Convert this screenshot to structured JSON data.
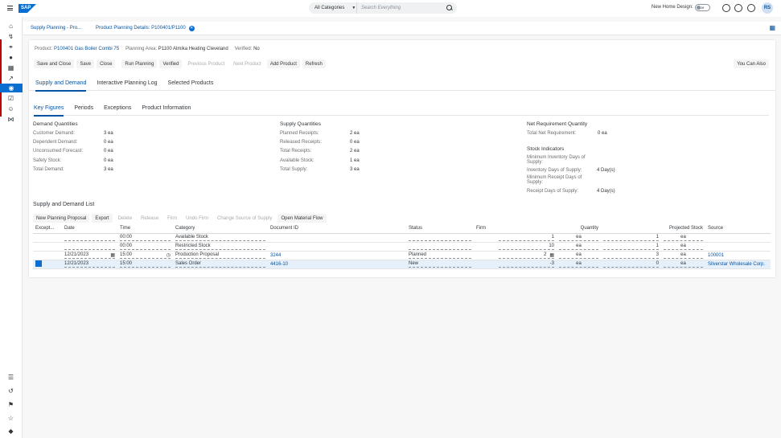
{
  "shell": {
    "category": "All Categories",
    "search_placeholder": "Search Everything",
    "new_home_label": "New Home Design:",
    "toggle_label": "Off",
    "avatar": "RS",
    "logo": "SAP"
  },
  "breadcrumbs": {
    "first": "Supply Planning - Pro...",
    "second": "Product Planning Details: P100401/P1100"
  },
  "header": {
    "product_label": "Product:",
    "product_value": "P100401 Gas Boiler Combi 75",
    "area_label": "Planning Area:",
    "area_value": "P1100 Almika Heating Cleveland",
    "verified_label": "Verified:",
    "verified_value": "No"
  },
  "toolbar": {
    "save_close": "Save and Close",
    "save": "Save",
    "close": "Close",
    "run_planning": "Run Planning",
    "verified": "Verified",
    "previous": "Previous Product",
    "next": "Next Product",
    "add": "Add Product",
    "refresh": "Refresh",
    "you_can_also": "You Can Also"
  },
  "tabs": [
    "Supply and Demand",
    "Interactive Planning Log",
    "Selected Products"
  ],
  "subtabs": [
    "Key Figures",
    "Periods",
    "Exceptions",
    "Product Information"
  ],
  "demand": {
    "title": "Demand Quantities",
    "rows": [
      {
        "k": "Customer Demand:",
        "v": "3 ea"
      },
      {
        "k": "Dependent Demand:",
        "v": "0 ea"
      },
      {
        "k": "Unconsumed Forecast:",
        "v": "0 ea"
      },
      {
        "k": "Safety Stock:",
        "v": "0 ea"
      },
      {
        "k": "Total Demand:",
        "v": "3 ea"
      }
    ]
  },
  "supply": {
    "title": "Supply Quantities",
    "rows": [
      {
        "k": "Planned Receipts:",
        "v": "2 ea"
      },
      {
        "k": "Released Receipts:",
        "v": "0 ea"
      },
      {
        "k": "Total Receipts:",
        "v": "2 ea"
      },
      {
        "k": "Available Stock:",
        "v": "1 ea"
      },
      {
        "k": "Total Supply:",
        "v": "3 ea"
      }
    ]
  },
  "net": {
    "title": "Net Requirement Quantity",
    "k": "Total Net Requirement:",
    "v": "0 ea"
  },
  "stock": {
    "title": "Stock Indicators",
    "rows": [
      {
        "k": "Minimum Inventory Days of Supply:",
        "v": ""
      },
      {
        "k": "Inventory Days of Supply:",
        "v": "4 Day(s)"
      },
      {
        "k": "Minimum Receipt Days of Supply:",
        "v": ""
      },
      {
        "k": "Receipt Days of Supply:",
        "v": "4 Day(s)"
      }
    ]
  },
  "list": {
    "title": "Supply and Demand List",
    "buttons": {
      "new_proposal": "New Planning Proposal",
      "export": "Export",
      "delete": "Delete",
      "release": "Release",
      "firm": "Firm",
      "unfirm": "Undo Firm",
      "change_source": "Change Source of Supply",
      "material_flow": "Open Material Flow"
    },
    "columns": {
      "exception": "Except...",
      "date": "Date",
      "time": "Time",
      "category": "Category",
      "document": "Document ID",
      "status": "Status",
      "firm": "Firm",
      "quantity": "Quantity",
      "projected": "Projected Stock",
      "source": "Source"
    },
    "rows": [
      {
        "date": "",
        "time": "00:00",
        "category": "Available Stock",
        "document": "",
        "status": "",
        "qty": "1",
        "unit": "ea",
        "proj": "1",
        "proj_unit": "ea",
        "source": ""
      },
      {
        "date": "",
        "time": "00:00",
        "category": "Restricted Stock",
        "document": "",
        "status": "",
        "qty": "10",
        "unit": "ea",
        "proj": "1",
        "proj_unit": "ea",
        "source": ""
      },
      {
        "date": "12/21/2023",
        "time": "15:00",
        "category": "Production Proposal",
        "document": "3244",
        "status": "Planned",
        "qty": "2",
        "unit": "ea",
        "proj": "3",
        "proj_unit": "ea",
        "source": "100001"
      },
      {
        "date": "12/21/2023",
        "time": "15:00",
        "category": "Sales Order",
        "document": "4416-10",
        "status": "New",
        "qty": "-3",
        "unit": "ea",
        "proj": "0",
        "proj_unit": "ea",
        "source": "Silverstar Wholesale Corp."
      }
    ]
  }
}
